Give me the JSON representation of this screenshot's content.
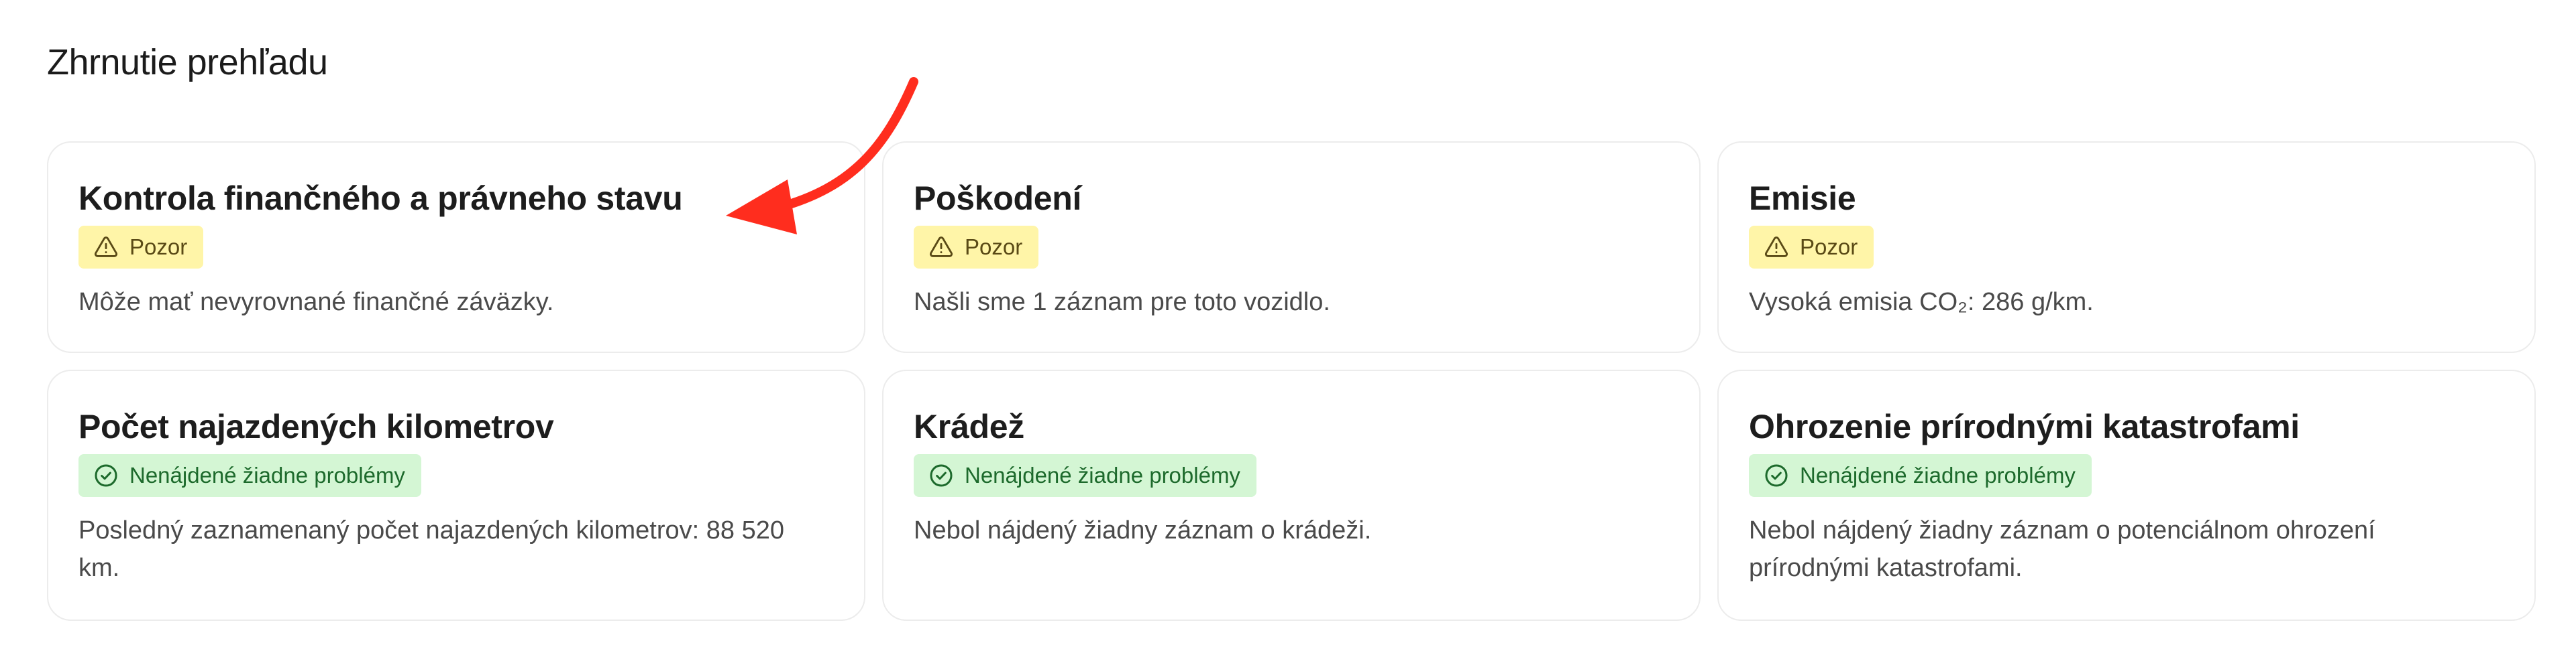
{
  "page": {
    "title": "Zhrnutie prehľadu"
  },
  "colors": {
    "warning_bg": "#fff5a8",
    "ok_bg": "#d4f6d4",
    "annotation_arrow": "#ff2d1e"
  },
  "cards": [
    {
      "title": "Kontrola finančného a právneho stavu",
      "status": "warning",
      "badge_icon": "warning-triangle-icon",
      "badge_label": "Pozor",
      "description": "Môže mať nevyrovnané finančné záväzky."
    },
    {
      "title": "Poškodení",
      "status": "warning",
      "badge_icon": "warning-triangle-icon",
      "badge_label": "Pozor",
      "description": "Našli sme 1 záznam pre toto vozidlo."
    },
    {
      "title": "Emisie",
      "status": "warning",
      "badge_icon": "warning-triangle-icon",
      "badge_label": "Pozor",
      "description": "Vysoká emisia CO₂: 286 g/km."
    },
    {
      "title": "Počet najazdených kilometrov",
      "status": "ok",
      "badge_icon": "check-circle-icon",
      "badge_label": "Nenájdené žiadne problémy",
      "description": "Posledný zaznamenaný počet najazdených kilometrov: 88 520 km."
    },
    {
      "title": "Krádež",
      "status": "ok",
      "badge_icon": "check-circle-icon",
      "badge_label": "Nenájdené žiadne problémy",
      "description": "Nebol nájdený žiadny záznam o krádeži."
    },
    {
      "title": "Ohrozenie prírodnými katastrofami",
      "status": "ok",
      "badge_icon": "check-circle-icon",
      "badge_label": "Nenájdené žiadne problémy",
      "description": "Nebol nájdený žiadny záznam o potenciálnom ohrození prírodnými katastrofami."
    }
  ]
}
